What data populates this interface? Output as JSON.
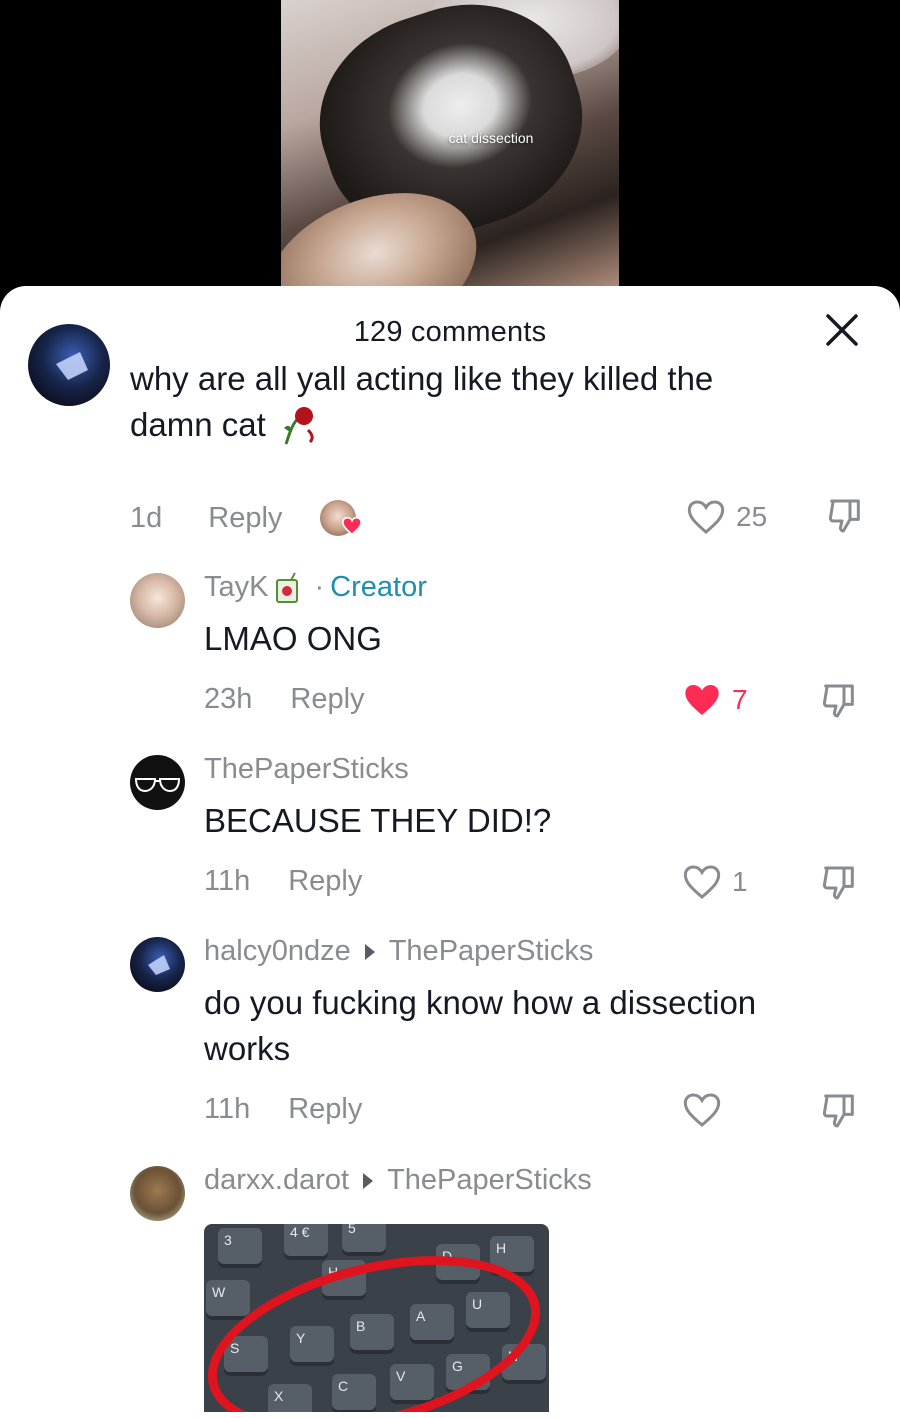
{
  "video": {
    "caption": "cat dissection"
  },
  "sheet": {
    "title": "129 comments",
    "close_icon": "close-icon"
  },
  "comments": [
    {
      "text_line1": "why are all yall acting like they killed the",
      "text_line2": "damn cat",
      "emoji_icon": "wilted-rose-icon",
      "time": "1d",
      "reply_label": "Reply",
      "likes": "25",
      "liked": false
    },
    {
      "username": "TayK",
      "badge_label": "Creator",
      "badge_separator": "·",
      "text": "LMAO ONG",
      "time": "23h",
      "reply_label": "Reply",
      "likes": "7",
      "liked": true
    },
    {
      "username": "ThePaperSticks",
      "text": "BECAUSE THEY DID!?",
      "time": "11h",
      "reply_label": "Reply",
      "likes": "1",
      "liked": false
    },
    {
      "username": "halcy0ndze",
      "reply_to": "ThePaperSticks",
      "text_line1": "do you fucking know how a dissection",
      "text_line2": "works",
      "time": "11h",
      "reply_label": "Reply",
      "likes": "",
      "liked": false
    },
    {
      "username": "darxx.darot",
      "reply_to": "ThePaperSticks",
      "image_keys": [
        "3",
        "4 €",
        "5",
        "W",
        "S",
        "Y",
        "B",
        "A",
        "U",
        "H",
        "D",
        "C",
        "V",
        "G",
        "N",
        "X",
        "H"
      ]
    }
  ],
  "colors": {
    "liked_heart": "#fe2c55",
    "creator_badge": "#1f8fb0",
    "meta_gray": "#8a8b91",
    "text": "#161823"
  }
}
